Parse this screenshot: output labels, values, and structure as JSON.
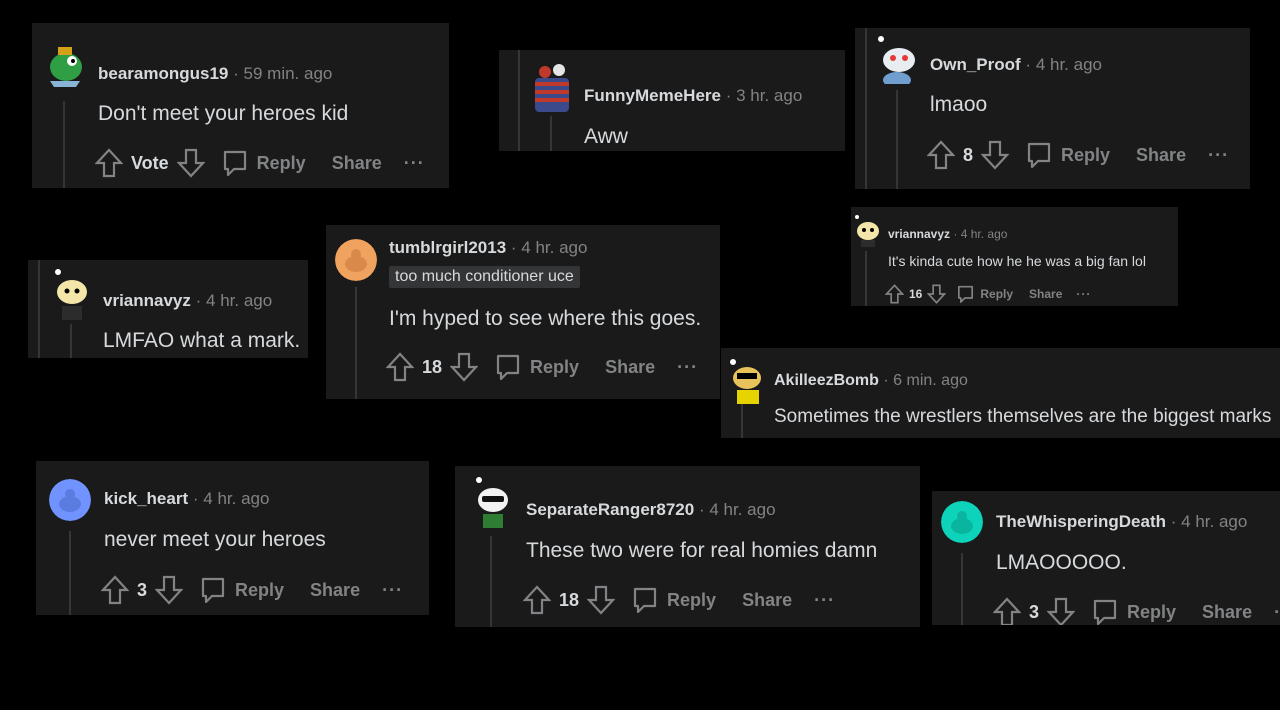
{
  "comments": [
    {
      "username": "bearamongus19",
      "time": "59 min. ago",
      "text": "Don't meet your heroes kid",
      "vote": "Vote",
      "reply": "Reply",
      "share": "Share",
      "more": "···"
    },
    {
      "username": "FunnyMemeHere",
      "time": "3 hr. ago",
      "text": "Aww"
    },
    {
      "username": "Own_Proof",
      "time": "4 hr. ago",
      "text": "lmaoo",
      "vote": "8",
      "reply": "Reply",
      "share": "Share",
      "more": "···"
    },
    {
      "username": "vriannavyz",
      "time": "4 hr. ago",
      "text": "It's kinda cute how he he was a big fan lol",
      "vote": "16",
      "reply": "Reply",
      "share": "Share",
      "more": "···"
    },
    {
      "username": "vriannavyz",
      "time": "4 hr. ago",
      "text": "LMFAO what a mark."
    },
    {
      "username": "tumblrgirl2013",
      "time": "4 hr. ago",
      "flair": "too much conditioner uce",
      "text": "I'm hyped to see where this goes.",
      "vote": "18",
      "reply": "Reply",
      "share": "Share",
      "more": "···"
    },
    {
      "username": "AkilleezBomb",
      "time": "6 min. ago",
      "text": "Sometimes the wrestlers themselves are the biggest marks"
    },
    {
      "username": "kick_heart",
      "time": "4 hr. ago",
      "text": "never meet your heroes",
      "vote": "3",
      "reply": "Reply",
      "share": "Share",
      "more": "···"
    },
    {
      "username": "SeparateRanger8720",
      "time": "4 hr. ago",
      "text": "These two were for real homies damn",
      "vote": "18",
      "reply": "Reply",
      "share": "Share",
      "more": "···"
    },
    {
      "username": "TheWhisperingDeath",
      "time": "4 hr. ago",
      "text": "LMAOOOOO.",
      "vote": "3",
      "reply": "Reply",
      "share": "Share",
      "more": "·"
    }
  ],
  "separator": "·",
  "icons": [
    "upvote-icon",
    "downvote-icon",
    "comment-icon",
    "snoo-avatar-icon"
  ],
  "colors": {
    "card": "#1a1a1b",
    "text": "#d7dadc",
    "muted": "#818384",
    "thread": "#343536"
  }
}
